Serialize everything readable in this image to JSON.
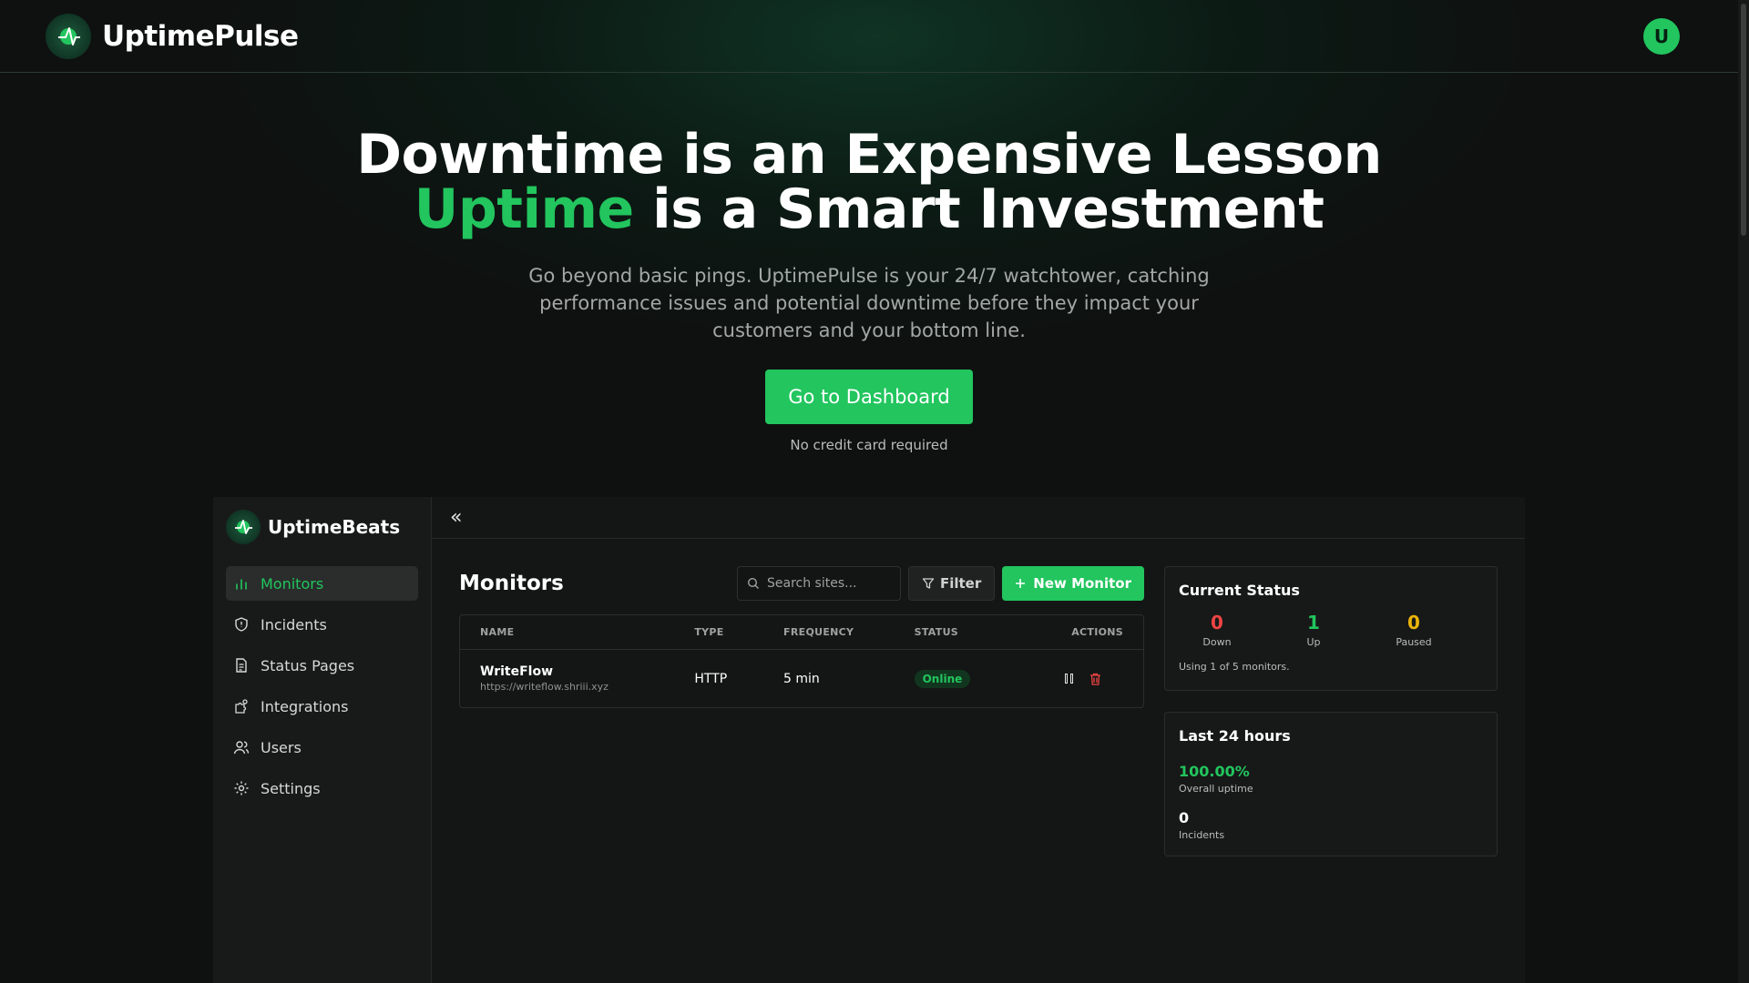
{
  "nav": {
    "brand": "UptimePulse",
    "avatar_initial": "U"
  },
  "hero": {
    "title_line1": "Downtime is an Expensive Lesson",
    "title_accent": "Uptime",
    "title_line2_rest": " is a Smart Investment",
    "subtitle": "Go beyond basic pings. UptimePulse is your 24/7 watchtower, catching performance issues and potential downtime before they impact your customers and your bottom line.",
    "cta_label": "Go to Dashboard",
    "cta_note": "No credit card required"
  },
  "dashboard": {
    "brand": "UptimeBeats",
    "collapse_glyph": "«",
    "sidebar": {
      "items": [
        {
          "label": "Monitors",
          "icon": "bar-chart-icon",
          "active": true
        },
        {
          "label": "Incidents",
          "icon": "shield-icon"
        },
        {
          "label": "Status Pages",
          "icon": "document-icon"
        },
        {
          "label": "Integrations",
          "icon": "puzzle-icon"
        },
        {
          "label": "Users",
          "icon": "users-icon"
        },
        {
          "label": "Settings",
          "icon": "gear-icon"
        }
      ]
    },
    "monitors": {
      "title": "Monitors",
      "search_placeholder": "Search sites...",
      "filter_label": "Filter",
      "new_label": "New Monitor",
      "columns": [
        "NAME",
        "TYPE",
        "FREQUENCY",
        "STATUS",
        "ACTIONS"
      ],
      "rows": [
        {
          "name": "WriteFlow",
          "url": "https://writeflow.shriii.xyz",
          "type": "HTTP",
          "frequency": "5 min",
          "status": "Online"
        }
      ]
    },
    "current_status": {
      "title": "Current Status",
      "down": {
        "value": "0",
        "label": "Down",
        "color": "#ef4444"
      },
      "up": {
        "value": "1",
        "label": "Up",
        "color": "#22c55e"
      },
      "paused": {
        "value": "0",
        "label": "Paused",
        "color": "#eab308"
      },
      "usage": "Using 1 of 5 monitors."
    },
    "last24": {
      "title": "Last 24 hours",
      "uptime": "100.00%",
      "uptime_label": "Overall uptime",
      "incidents": "0",
      "incidents_label": "Incidents"
    }
  },
  "colors": {
    "accent": "#22c55e",
    "danger": "#ef4444",
    "warning": "#eab308"
  }
}
